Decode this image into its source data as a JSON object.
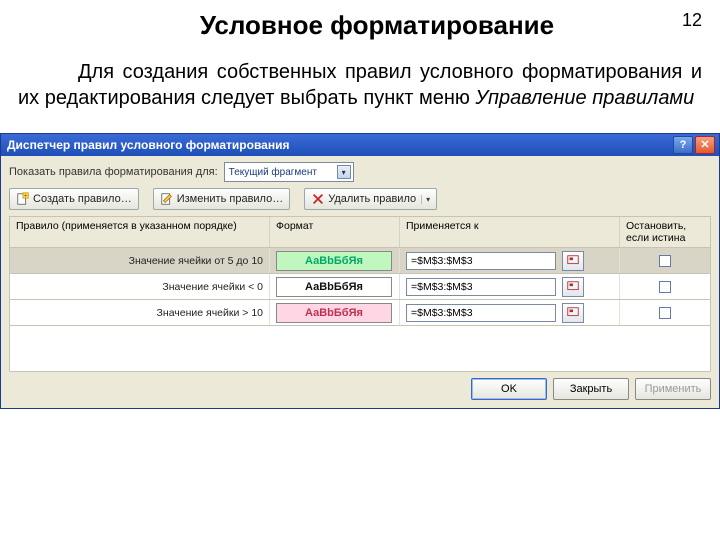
{
  "page": {
    "title": "Условное форматирование",
    "number": "12",
    "body_prefix": "Для создания собственных правил условного форматирования и их редактирования следует выбрать пункт меню ",
    "body_em": "Управление правилами"
  },
  "dialog": {
    "title": "Диспетчер правил условного форматирования",
    "scope_label": "Показать правила форматирования для:",
    "scope_value": "Текущий фрагмент",
    "toolbar": {
      "new": "Создать правило…",
      "edit": "Изменить правило…",
      "delete": "Удалить правило"
    },
    "columns": {
      "rule": "Правило (применяется в указанном порядке)",
      "format": "Формат",
      "applies": "Применяется к",
      "stop": "Остановить, если истина"
    },
    "sample": "АаВbБбЯя",
    "rules": [
      {
        "desc": "Значение ячейки от 5 до 10",
        "ref": "=$M$3:$M$3",
        "style": "green",
        "selected": true
      },
      {
        "desc": "Значение ячейки < 0",
        "ref": "=$M$3:$M$3",
        "style": "white",
        "selected": false
      },
      {
        "desc": "Значение ячейки > 10",
        "ref": "=$M$3:$M$3",
        "style": "pink",
        "selected": false
      }
    ],
    "buttons": {
      "ok": "OK",
      "close": "Закрыть",
      "apply": "Применить"
    }
  }
}
